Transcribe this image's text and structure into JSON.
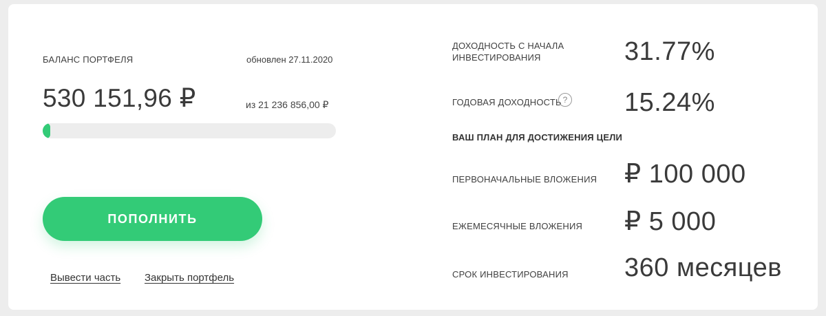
{
  "balance": {
    "label": "БАЛАНС ПОРТФЕЛЯ",
    "updated": "обновлен 27.11.2020",
    "amount": "530 151,96 ₽",
    "target": "из 21 236 856,00 ₽",
    "progress_fraction": 0.025
  },
  "actions": {
    "topup_label": "ПОПОЛНИТЬ",
    "withdraw_label": "Вывести часть",
    "close_label": "Закрыть портфель"
  },
  "stats": {
    "total_return_label_line1": "ДОХОДНОСТЬ С НАЧАЛА",
    "total_return_label_line2": "ИНВЕСТИРОВАНИЯ",
    "total_return_value": "31.77%",
    "annual_return_label": "ГОДОВАЯ ДОХОДНОСТЬ",
    "help_glyph": "?",
    "annual_return_value": "15.24%"
  },
  "plan": {
    "title": "ВАШ ПЛАН ДЛЯ ДОСТИЖЕНИЯ ЦЕЛИ",
    "initial_label": "ПЕРВОНАЧАЛЬНЫЕ ВЛОЖЕНИЯ",
    "initial_value": "₽ 100 000",
    "monthly_label": "ЕЖЕМЕСЯЧНЫЕ ВЛОЖЕНИЯ",
    "monthly_value": "₽ 5 000",
    "term_label": "СРОК ИНВЕСТИРОВАНИЯ",
    "term_value": "360 месяцев"
  },
  "colors": {
    "accent": "#33cb77",
    "track": "#ededed"
  }
}
